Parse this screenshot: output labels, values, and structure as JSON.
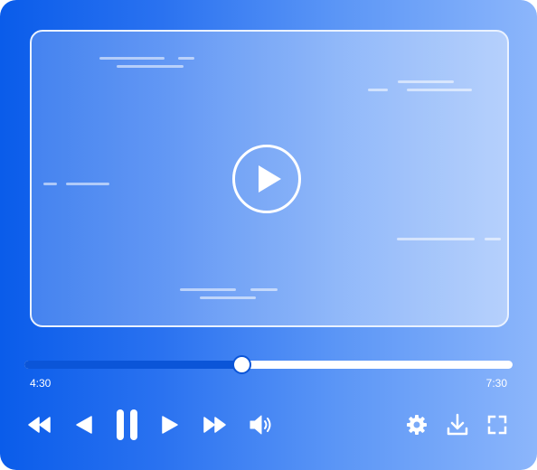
{
  "player": {
    "current_time": "4:30",
    "duration": "7:30",
    "progress": 0.444
  },
  "icons": {
    "big_play": "play-icon",
    "rewind": "rewind-icon",
    "previous": "previous-icon",
    "pause": "pause-icon",
    "next": "next-icon",
    "fast_forward": "fast-forward-icon",
    "volume": "volume-icon",
    "settings": "gear-icon",
    "download": "download-icon",
    "fullscreen": "fullscreen-icon"
  },
  "colors": {
    "gradient_start": "#0a5cea",
    "gradient_end": "#8cb6fb",
    "progress_fill": "#0b55d8",
    "foreground": "#ffffff"
  }
}
